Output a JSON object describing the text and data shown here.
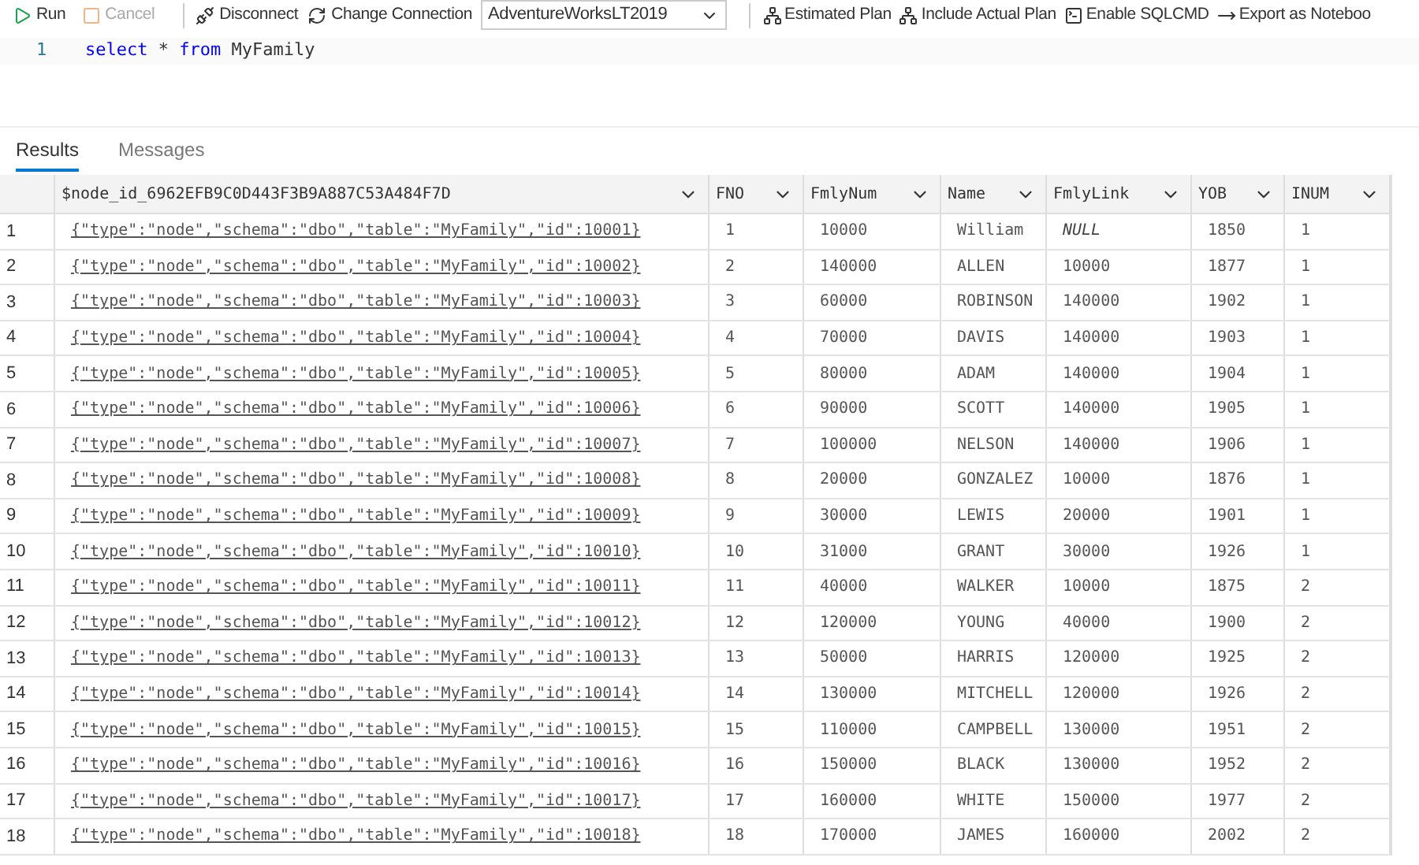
{
  "toolbar": {
    "items": [
      {
        "kind": "run",
        "label": "Run",
        "disabled": false
      },
      {
        "kind": "cancel",
        "label": "Cancel",
        "disabled": true
      },
      {
        "kind": "disconnect",
        "label": "Disconnect",
        "disabled": false
      },
      {
        "kind": "change",
        "label": "Change Connection",
        "disabled": false
      }
    ],
    "database": "AdventureWorksLT2019",
    "actions": [
      {
        "kind": "plan",
        "label": "Estimated Plan"
      },
      {
        "kind": "plan",
        "label": "Include Actual Plan"
      },
      {
        "kind": "sqlcmd",
        "label": "Enable SQLCMD"
      },
      {
        "kind": "export",
        "label": "Export as Noteboo"
      }
    ]
  },
  "editor": {
    "lines": [
      {
        "number": "1",
        "tokens": [
          {
            "kind": "keyword",
            "text": "select"
          },
          {
            "kind": "plain",
            "text": "*"
          },
          {
            "kind": "keyword",
            "text": "from"
          },
          {
            "kind": "plain",
            "text": "MyFamily"
          }
        ]
      }
    ]
  },
  "results": {
    "tabs": [
      {
        "label": "Results",
        "selected": true
      },
      {
        "label": "Messages",
        "selected": false
      }
    ],
    "columns": [
      "$node_id_6962EFB9C0D443F3B9A887C53A484F7D",
      "FNO",
      "FmlyNum",
      "Name",
      "FmlyLink",
      "YOB",
      "INUM"
    ],
    "rows": [
      {
        "number": "1",
        "cells": [
          "{\"type\":\"node\",\"schema\":\"dbo\",\"table\":\"MyFamily\",\"id\":10001}",
          "1",
          "10000",
          "William",
          "NULL",
          "1850",
          "1"
        ],
        "link_null": true
      },
      {
        "number": "2",
        "cells": [
          "{\"type\":\"node\",\"schema\":\"dbo\",\"table\":\"MyFamily\",\"id\":10002}",
          "2",
          "140000",
          "ALLEN",
          "10000",
          "1877",
          "1"
        ],
        "link_null": false
      },
      {
        "number": "3",
        "cells": [
          "{\"type\":\"node\",\"schema\":\"dbo\",\"table\":\"MyFamily\",\"id\":10003}",
          "3",
          "60000",
          "ROBINSON",
          "140000",
          "1902",
          "1"
        ],
        "link_null": false
      },
      {
        "number": "4",
        "cells": [
          "{\"type\":\"node\",\"schema\":\"dbo\",\"table\":\"MyFamily\",\"id\":10004}",
          "4",
          "70000",
          "DAVIS",
          "140000",
          "1903",
          "1"
        ],
        "link_null": false
      },
      {
        "number": "5",
        "cells": [
          "{\"type\":\"node\",\"schema\":\"dbo\",\"table\":\"MyFamily\",\"id\":10005}",
          "5",
          "80000",
          "ADAM",
          "140000",
          "1904",
          "1"
        ],
        "link_null": false
      },
      {
        "number": "6",
        "cells": [
          "{\"type\":\"node\",\"schema\":\"dbo\",\"table\":\"MyFamily\",\"id\":10006}",
          "6",
          "90000",
          "SCOTT",
          "140000",
          "1905",
          "1"
        ],
        "link_null": false
      },
      {
        "number": "7",
        "cells": [
          "{\"type\":\"node\",\"schema\":\"dbo\",\"table\":\"MyFamily\",\"id\":10007}",
          "7",
          "100000",
          "NELSON",
          "140000",
          "1906",
          "1"
        ],
        "link_null": false
      },
      {
        "number": "8",
        "cells": [
          "{\"type\":\"node\",\"schema\":\"dbo\",\"table\":\"MyFamily\",\"id\":10008}",
          "8",
          "20000",
          "GONZALEZ",
          "10000",
          "1876",
          "1"
        ],
        "link_null": false
      },
      {
        "number": "9",
        "cells": [
          "{\"type\":\"node\",\"schema\":\"dbo\",\"table\":\"MyFamily\",\"id\":10009}",
          "9",
          "30000",
          "LEWIS",
          "20000",
          "1901",
          "1"
        ],
        "link_null": false
      },
      {
        "number": "10",
        "cells": [
          "{\"type\":\"node\",\"schema\":\"dbo\",\"table\":\"MyFamily\",\"id\":10010}",
          "10",
          "31000",
          "GRANT",
          "30000",
          "1926",
          "1"
        ],
        "link_null": false
      },
      {
        "number": "11",
        "cells": [
          "{\"type\":\"node\",\"schema\":\"dbo\",\"table\":\"MyFamily\",\"id\":10011}",
          "11",
          "40000",
          "WALKER",
          "10000",
          "1875",
          "2"
        ],
        "link_null": false
      },
      {
        "number": "12",
        "cells": [
          "{\"type\":\"node\",\"schema\":\"dbo\",\"table\":\"MyFamily\",\"id\":10012}",
          "12",
          "120000",
          "YOUNG",
          "40000",
          "1900",
          "2"
        ],
        "link_null": false
      },
      {
        "number": "13",
        "cells": [
          "{\"type\":\"node\",\"schema\":\"dbo\",\"table\":\"MyFamily\",\"id\":10013}",
          "13",
          "50000",
          "HARRIS",
          "120000",
          "1925",
          "2"
        ],
        "link_null": false
      },
      {
        "number": "14",
        "cells": [
          "{\"type\":\"node\",\"schema\":\"dbo\",\"table\":\"MyFamily\",\"id\":10014}",
          "14",
          "130000",
          "MITCHELL",
          "120000",
          "1926",
          "2"
        ],
        "link_null": false
      },
      {
        "number": "15",
        "cells": [
          "{\"type\":\"node\",\"schema\":\"dbo\",\"table\":\"MyFamily\",\"id\":10015}",
          "15",
          "110000",
          "CAMPBELL",
          "130000",
          "1951",
          "2"
        ],
        "link_null": false
      },
      {
        "number": "16",
        "cells": [
          "{\"type\":\"node\",\"schema\":\"dbo\",\"table\":\"MyFamily\",\"id\":10016}",
          "16",
          "150000",
          "BLACK",
          "130000",
          "1952",
          "2"
        ],
        "link_null": false
      },
      {
        "number": "17",
        "cells": [
          "{\"type\":\"node\",\"schema\":\"dbo\",\"table\":\"MyFamily\",\"id\":10017}",
          "17",
          "160000",
          "WHITE",
          "150000",
          "1977",
          "2"
        ],
        "link_null": false
      },
      {
        "number": "18",
        "cells": [
          "{\"type\":\"node\",\"schema\":\"dbo\",\"table\":\"MyFamily\",\"id\":10018}",
          "18",
          "170000",
          "JAMES",
          "160000",
          "2002",
          "2"
        ],
        "link_null": false
      }
    ]
  }
}
